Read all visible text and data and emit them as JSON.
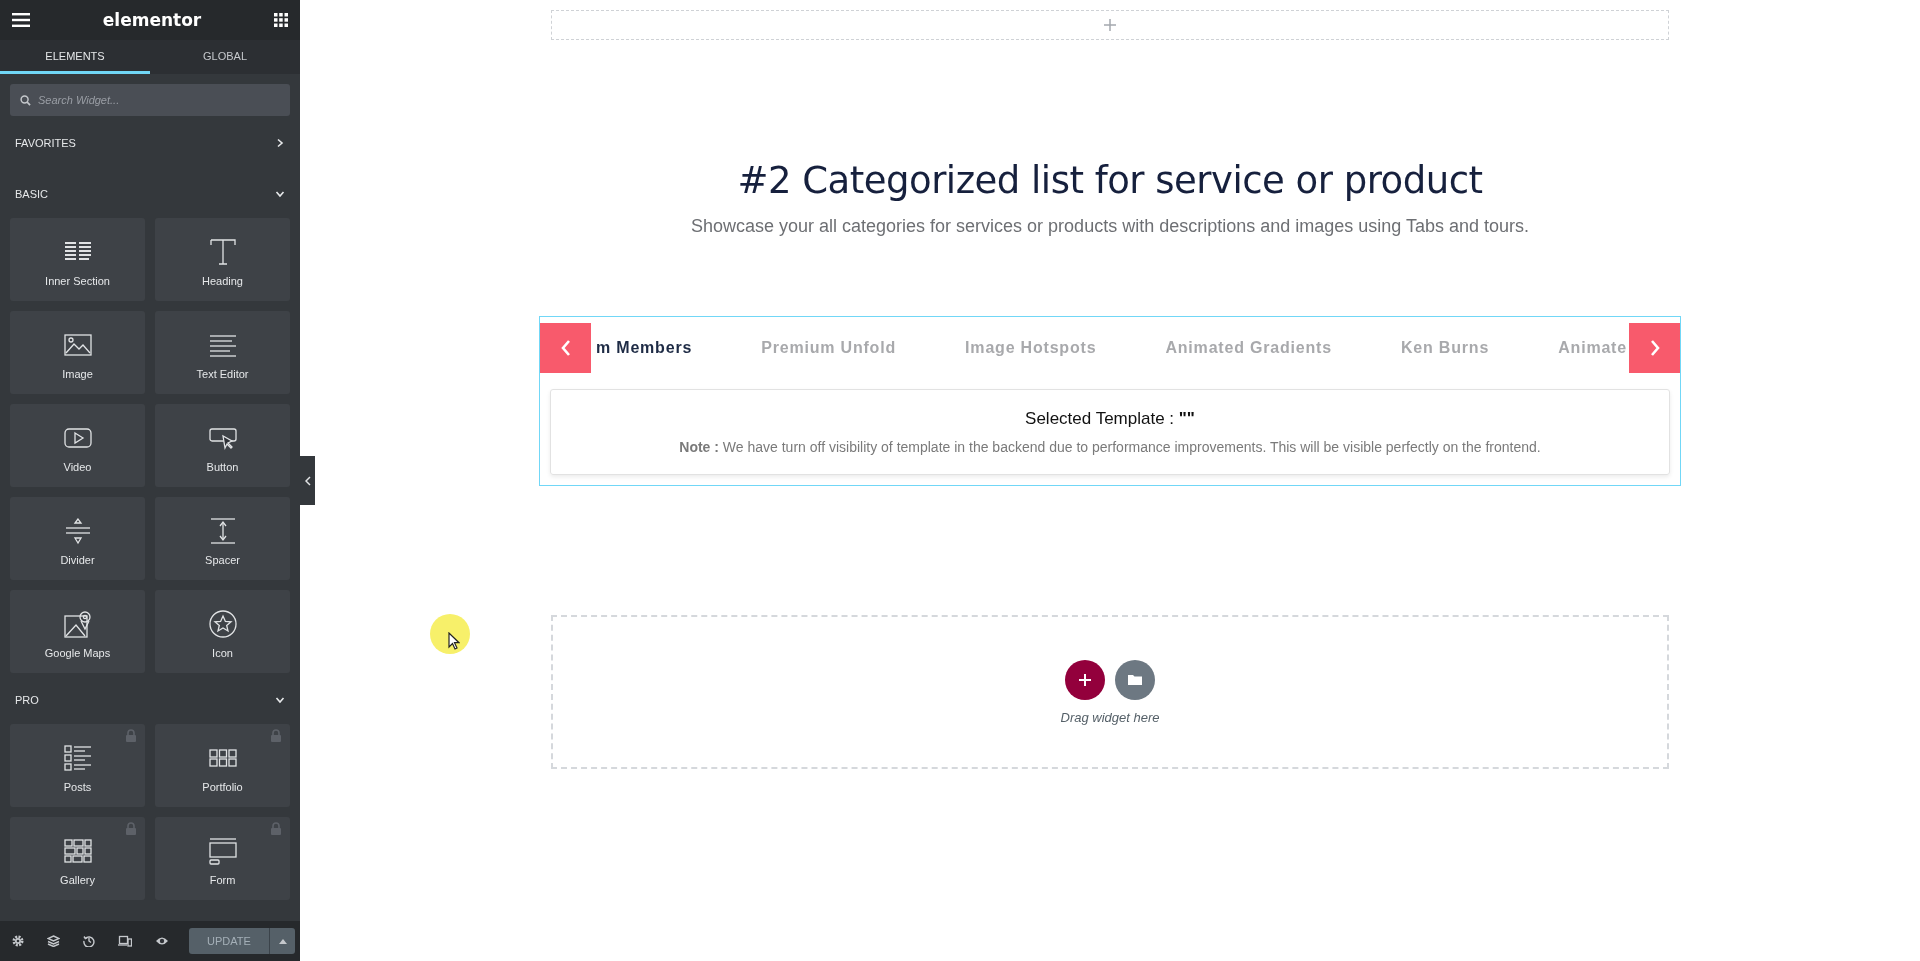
{
  "sidebar": {
    "brand": "elementor",
    "tabs": [
      {
        "label": "ELEMENTS",
        "selected": true
      },
      {
        "label": "GLOBAL",
        "selected": false
      }
    ],
    "search": {
      "placeholder": "Search Widget..."
    },
    "sections": [
      {
        "title": "FAVORITES",
        "expanded": false
      },
      {
        "title": "BASIC",
        "expanded": true,
        "widgets": [
          {
            "label": "Inner Section",
            "kind": "columns",
            "locked": false
          },
          {
            "label": "Heading",
            "kind": "heading",
            "locked": false
          },
          {
            "label": "Image",
            "kind": "image",
            "locked": false
          },
          {
            "label": "Text Editor",
            "kind": "text",
            "locked": false
          },
          {
            "label": "Video",
            "kind": "video",
            "locked": false
          },
          {
            "label": "Button",
            "kind": "button",
            "locked": false
          },
          {
            "label": "Divider",
            "kind": "divider",
            "locked": false
          },
          {
            "label": "Spacer",
            "kind": "spacer",
            "locked": false
          },
          {
            "label": "Google Maps",
            "kind": "map",
            "locked": false
          },
          {
            "label": "Icon",
            "kind": "star",
            "locked": false
          }
        ]
      },
      {
        "title": "PRO",
        "expanded": true,
        "widgets": [
          {
            "label": "Posts",
            "kind": "posts",
            "locked": true
          },
          {
            "label": "Portfolio",
            "kind": "portfolio",
            "locked": true
          },
          {
            "label": "Gallery",
            "kind": "gallery",
            "locked": true
          },
          {
            "label": "Form",
            "kind": "form",
            "locked": true
          }
        ]
      }
    ],
    "footer": {
      "update_button": {
        "label": "UPDATE",
        "disabled": true
      }
    }
  },
  "canvas": {
    "heading": "#2 Categorized list for service or product",
    "subheading": "Showcase your all categories for services or products with descriptions and images using Tabs and tours.",
    "tabs": [
      {
        "label": "m Members",
        "selected": true
      },
      {
        "label": "Premium Unfold",
        "selected": false
      },
      {
        "label": "Image Hotspots",
        "selected": false
      },
      {
        "label": "Animated Gradients",
        "selected": false
      },
      {
        "label": "Ken Burns",
        "selected": false
      },
      {
        "label": "Animate",
        "selected": false
      }
    ],
    "selected_template": "Selected Template : **\"\"**",
    "note": "**Note :** We have turn off visibility of template in the backend due to performance improvements. This will be visible perfectly on the frontend.",
    "drop_zone": {
      "hint": "Drag widget here"
    }
  }
}
